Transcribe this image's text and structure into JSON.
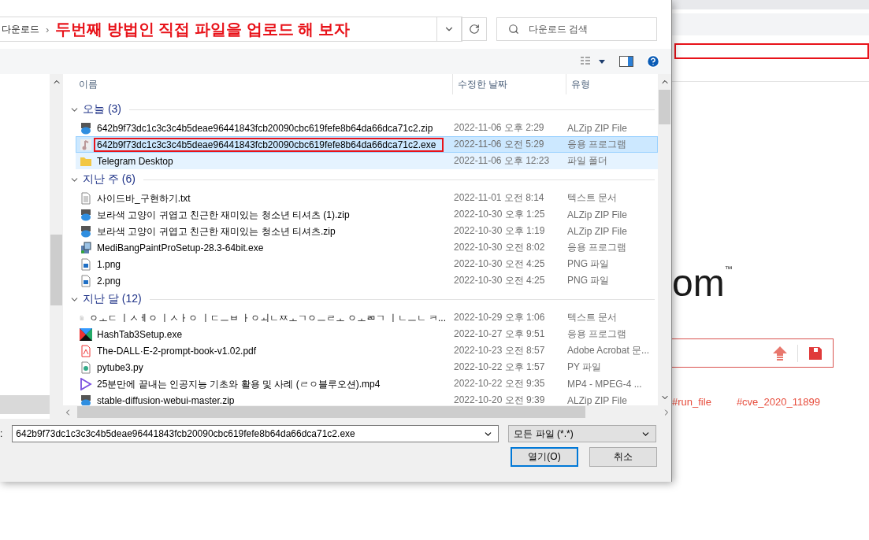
{
  "address_bar": {
    "crumb": "다운로드",
    "separator": "›",
    "annotation": "두번째 방법인 직접 파일을 업로드 해 보자",
    "search_placeholder": "다운로드 검색"
  },
  "columns": [
    "이름",
    "수정한 날짜",
    "유형"
  ],
  "groups": [
    {
      "label": "오늘 (3)",
      "expanded": true,
      "items": [
        {
          "name": "642b9f73dc1c3c3c4b5deae96441843fcb20090cbc619fefe8b64da66dca71c2.zip",
          "date": "2022-11-06 오후 2:29",
          "type": "ALZip ZIP File",
          "kind": "zip",
          "selected": false,
          "hovered": false,
          "annotated": false
        },
        {
          "name": "642b9f73dc1c3c3c4b5deae96441843fcb20090cbc619fefe8b64da66dca71c2.exe",
          "date": "2022-11-06 오전 5:29",
          "type": "응용 프로그램",
          "kind": "note",
          "selected": true,
          "hovered": false,
          "annotated": true
        },
        {
          "name": "Telegram Desktop",
          "date": "2022-11-06 오후 12:23",
          "type": "파일 폴더",
          "kind": "folder",
          "selected": false,
          "hovered": true,
          "annotated": false
        }
      ]
    },
    {
      "label": "지난 주 (6)",
      "expanded": true,
      "items": [
        {
          "name": "사이드바_구현하기.txt",
          "date": "2022-11-01 오전 8:14",
          "type": "텍스트 문서",
          "kind": "text",
          "selected": false,
          "hovered": false,
          "annotated": false
        },
        {
          "name": "보라색 고양이 귀엽고 친근한 재미있는 청소년 티셔츠 (1).zip",
          "date": "2022-10-30 오후 1:25",
          "type": "ALZip ZIP File",
          "kind": "zip",
          "selected": false,
          "hovered": false,
          "annotated": false
        },
        {
          "name": "보라색 고양이 귀엽고 친근한 재미있는 청소년 티셔츠.zip",
          "date": "2022-10-30 오후 1:19",
          "type": "ALZip ZIP File",
          "kind": "zip",
          "selected": false,
          "hovered": false,
          "annotated": false
        },
        {
          "name": "MediBangPaintProSetup-28.3-64bit.exe",
          "date": "2022-10-30 오전 8:02",
          "type": "응용 프로그램",
          "kind": "installer",
          "selected": false,
          "hovered": false,
          "annotated": false
        },
        {
          "name": "1.png",
          "date": "2022-10-30 오전 4:25",
          "type": "PNG 파일",
          "kind": "image",
          "selected": false,
          "hovered": false,
          "annotated": false
        },
        {
          "name": "2.png",
          "date": "2022-10-30 오전 4:25",
          "type": "PNG 파일",
          "kind": "image",
          "selected": false,
          "hovered": false,
          "annotated": false
        }
      ]
    },
    {
      "label": "지난 달 (12)",
      "expanded": true,
      "items": [
        {
          "name": "ㅇㅗㄷ ㅣㅅㅔㅇ ㅣㅅㅏㅇ ㅣㄷㅡㅂ ㅏㅇㅚㄴㅉㅗㄱㅇㅡㄹㅗ ㅇㅗㄻㄱ ㅣㄴㅡㄴ ㅋ...",
          "date": "2022-10-29 오후 1:06",
          "type": "텍스트 문서",
          "kind": "text",
          "selected": false,
          "hovered": false,
          "annotated": false
        },
        {
          "name": "HashTab3Setup.exe",
          "date": "2022-10-27 오후 9:51",
          "type": "응용 프로그램",
          "kind": "tiles",
          "selected": false,
          "hovered": false,
          "annotated": false
        },
        {
          "name": "The-DALL·E-2-prompt-book-v1.02.pdf",
          "date": "2022-10-23 오전 8:57",
          "type": "Adobe Acrobat 문...",
          "kind": "pdf",
          "selected": false,
          "hovered": false,
          "annotated": false
        },
        {
          "name": "pytube3.py",
          "date": "2022-10-22 오후 1:57",
          "type": "PY 파일",
          "kind": "script",
          "selected": false,
          "hovered": false,
          "annotated": false
        },
        {
          "name": "25분만에 끝내는 인공지능 기초와 활용 및 사례 (ㄹㅇ블루오션).mp4",
          "date": "2022-10-22 오전 9:35",
          "type": "MP4 - MPEG-4 ...",
          "kind": "video",
          "selected": false,
          "hovered": false,
          "annotated": false
        },
        {
          "name": "stable-diffusion-webui-master.zip",
          "date": "2022-10-20 오전 9:39",
          "type": "ALZip ZIP File",
          "kind": "zip",
          "selected": false,
          "hovered": false,
          "annotated": false
        }
      ]
    }
  ],
  "file_name": {
    "label": ":",
    "value": "642b9f73dc1c3c3c4b5deae96441843fcb20090cbc619fefe8b64da66dca71c2.exe"
  },
  "file_type": "모든 파일 (*.*)",
  "buttons": [
    {
      "label": "열기(O)",
      "default": true
    },
    {
      "label": "취소",
      "default": false
    }
  ],
  "page": {
    "logo_fragment": "om",
    "trademark": "™",
    "tags": [
      "#run_file",
      "#cve_2020_11899"
    ]
  }
}
